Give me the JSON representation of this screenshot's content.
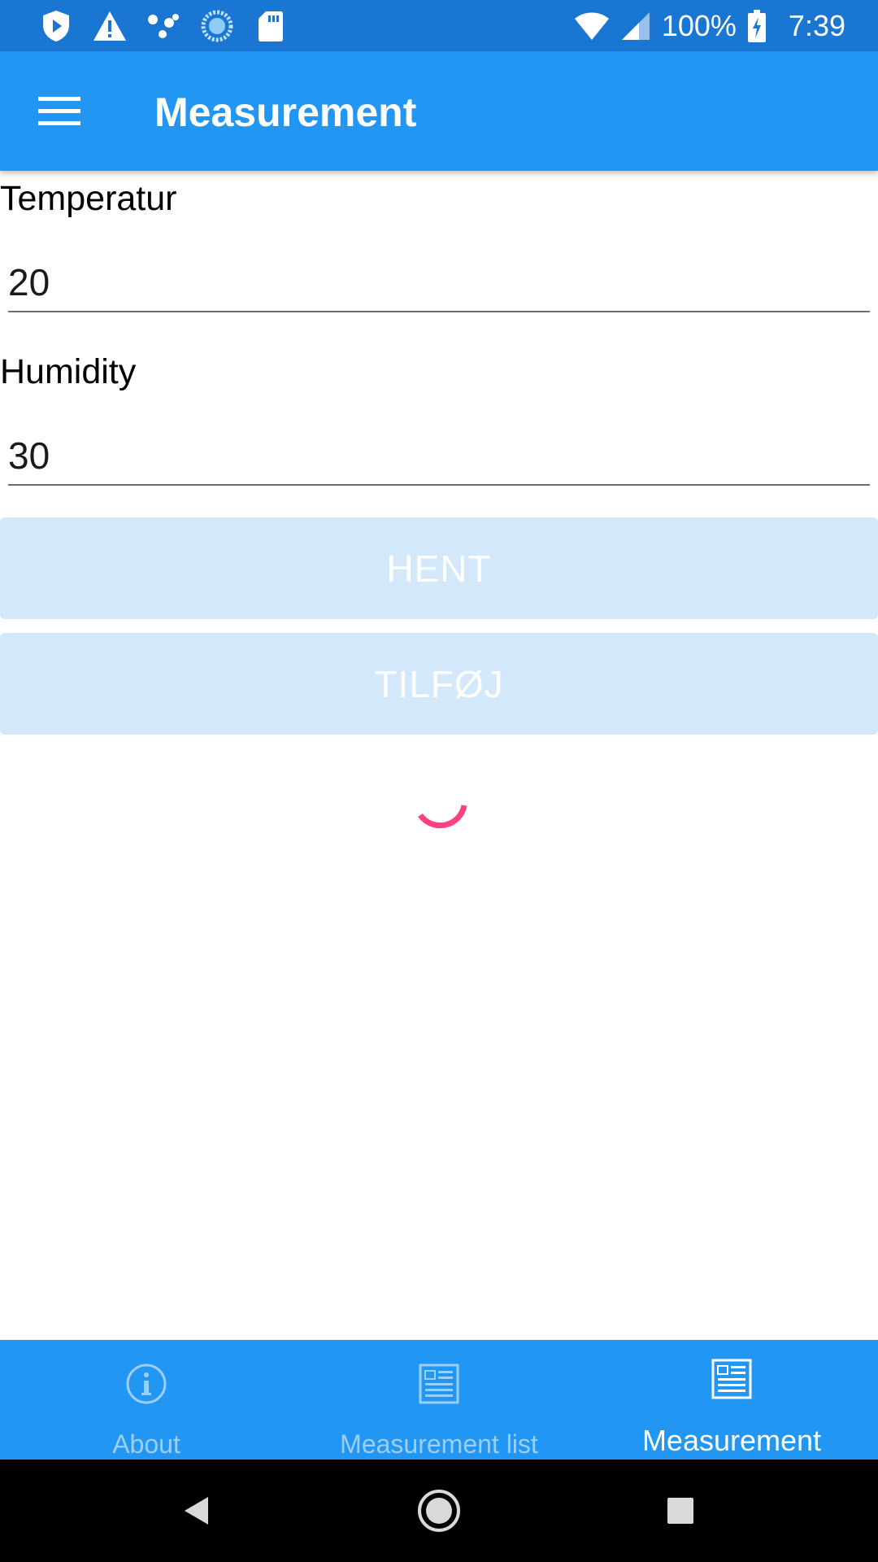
{
  "status_bar": {
    "battery": "100%",
    "time": "7:39",
    "icons": [
      "shield-play-icon",
      "warning-icon",
      "dots-icon",
      "sync-circle-icon",
      "sd-card-icon",
      "wifi-icon",
      "signal-icon",
      "battery-charging-icon"
    ]
  },
  "app_bar": {
    "title": "Measurement",
    "menu_icon": "hamburger-menu-icon"
  },
  "form": {
    "temperature_label": "Temperatur",
    "temperature_value": "20",
    "humidity_label": "Humidity",
    "humidity_value": "30"
  },
  "buttons": {
    "fetch_label": "HENT",
    "add_label": "TILFØJ"
  },
  "spinner": {
    "color": "#ff4081"
  },
  "tabs": [
    {
      "label": "About",
      "icon": "info-icon",
      "active": false
    },
    {
      "label": "Measurement list",
      "icon": "list-document-icon",
      "active": false
    },
    {
      "label": "Measurement",
      "icon": "document-icon",
      "active": true
    }
  ],
  "colors": {
    "primary": "#2196f3",
    "status_bar": "#1976d2",
    "button_disabled": "#d3e9fb",
    "accent": "#ff4081"
  }
}
